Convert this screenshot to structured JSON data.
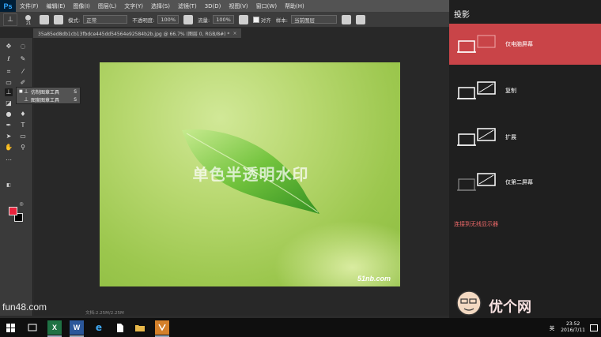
{
  "menubar": {
    "app_logo": "Ps",
    "items": [
      "文件(F)",
      "编辑(E)",
      "图像(I)",
      "图层(L)",
      "文字(Y)",
      "选择(S)",
      "滤镜(T)",
      "3D(D)",
      "视图(V)",
      "窗口(W)",
      "帮助(H)"
    ]
  },
  "options": {
    "brush_size": "21",
    "mode_label": "模式:",
    "mode_value": "正常",
    "opacity_label": "不透明度:",
    "opacity_value": "100%",
    "flow_label": "流量:",
    "flow_value": "100%",
    "aligned_label": "对齐",
    "sample_label": "样本:",
    "sample_value": "当前图层"
  },
  "document_tab": {
    "title": "35a85ed8db1cb13fbdce445dd54564e92584b2b.jpg @ 66.7% (图层 0, RGB/8#) *",
    "close": "×"
  },
  "flyout": {
    "items": [
      {
        "label": "仿制图章工具",
        "shortcut": "S",
        "selected": true
      },
      {
        "label": "图案图章工具",
        "shortcut": "S",
        "selected": false
      }
    ]
  },
  "canvas": {
    "watermark_text": "单色半透明水印",
    "brand_text": "51nb.com"
  },
  "statusbar": {
    "site_mark": "fun48.com",
    "doc_info": "文档:2.25M/2.25M"
  },
  "colors": {
    "foreground": "#e8233c",
    "background": "#000000",
    "project_active": "#c94448",
    "link": "#f06a6a"
  },
  "project_panel": {
    "title": "投影",
    "options": [
      {
        "label": "仅电脑屏幕",
        "icon": "pc-screen-only-icon",
        "selected": true
      },
      {
        "label": "复制",
        "icon": "duplicate-icon",
        "selected": false
      },
      {
        "label": "扩展",
        "icon": "extend-icon",
        "selected": false
      },
      {
        "label": "仅第二屏幕",
        "icon": "second-screen-only-icon",
        "selected": false
      }
    ],
    "wireless_link": "连接到无线显示器"
  },
  "taskbar": {
    "apps": [
      "windows-start-icon",
      "task-view-icon",
      "excel-icon",
      "word-icon",
      "edge-icon",
      "file-icon",
      "folder-icon",
      "photoshop-icon"
    ],
    "excel_letter": "X",
    "word_letter": "W",
    "language": "英",
    "time": "23:52",
    "date": "2016/7/11"
  },
  "corner_watermark": "优个网"
}
